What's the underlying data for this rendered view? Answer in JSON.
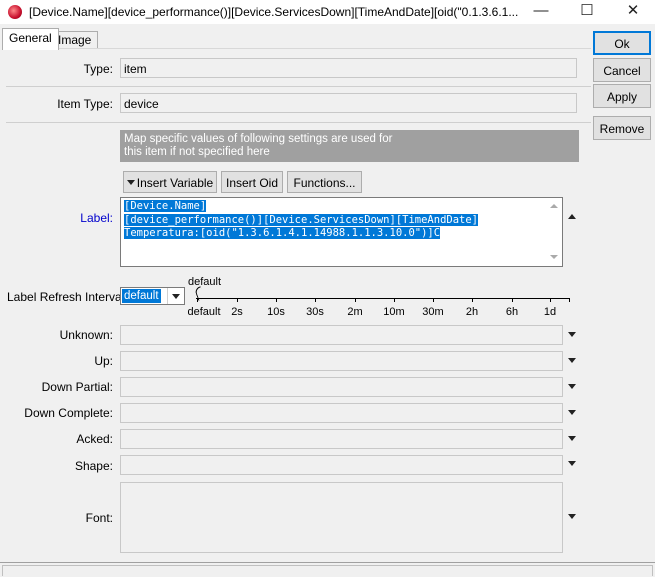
{
  "window": {
    "title": "[Device.Name][device_performance()][Device.ServicesDown][TimeAndDate][oid(\"0.1.3.6.1....",
    "minimize_glyph": "—",
    "maximize_glyph": "☐",
    "close_glyph": "✕"
  },
  "tabs": [
    {
      "label": "General",
      "active": true
    },
    {
      "label": "Image",
      "active": false
    }
  ],
  "form": {
    "type": {
      "label": "Type:",
      "value": "item"
    },
    "item_type": {
      "label": "Item Type:",
      "value": "device"
    },
    "info_text_line1": "Map specific values of following settings are used for",
    "info_text_line2": "this item if not specified here",
    "buttons": {
      "insert_variable": "Insert Variable",
      "insert_oid": "Insert Oid",
      "functions": "Functions..."
    },
    "label": {
      "label": "Label:",
      "lines": [
        "[Device.Name]",
        "[device_performance()][Device.ServicesDown][TimeAndDate]",
        "Temperatura:[oid(\"1.3.6.1.4.1.14988.1.1.3.10.0\")]C"
      ]
    },
    "refresh": {
      "label": "Label Refresh Interval:",
      "value": "default",
      "slider_value": "default",
      "ticks": [
        "default",
        "2s",
        "10s",
        "30s",
        "2m",
        "10m",
        "30m",
        "2h",
        "6h",
        "1d"
      ]
    },
    "unknown": {
      "label": "Unknown:",
      "value": ""
    },
    "up": {
      "label": "Up:",
      "value": ""
    },
    "down_partial": {
      "label": "Down Partial:",
      "value": ""
    },
    "down_complete": {
      "label": "Down Complete:",
      "value": ""
    },
    "acked": {
      "label": "Acked:",
      "value": ""
    },
    "shape": {
      "label": "Shape:",
      "value": ""
    },
    "font": {
      "label": "Font:",
      "value": ""
    }
  },
  "actions": {
    "ok": "Ok",
    "cancel": "Cancel",
    "apply": "Apply",
    "remove": "Remove"
  },
  "colors": {
    "selection": "#0078d7",
    "info_box": "#a0a0a0",
    "label_link": "#0000cc"
  }
}
